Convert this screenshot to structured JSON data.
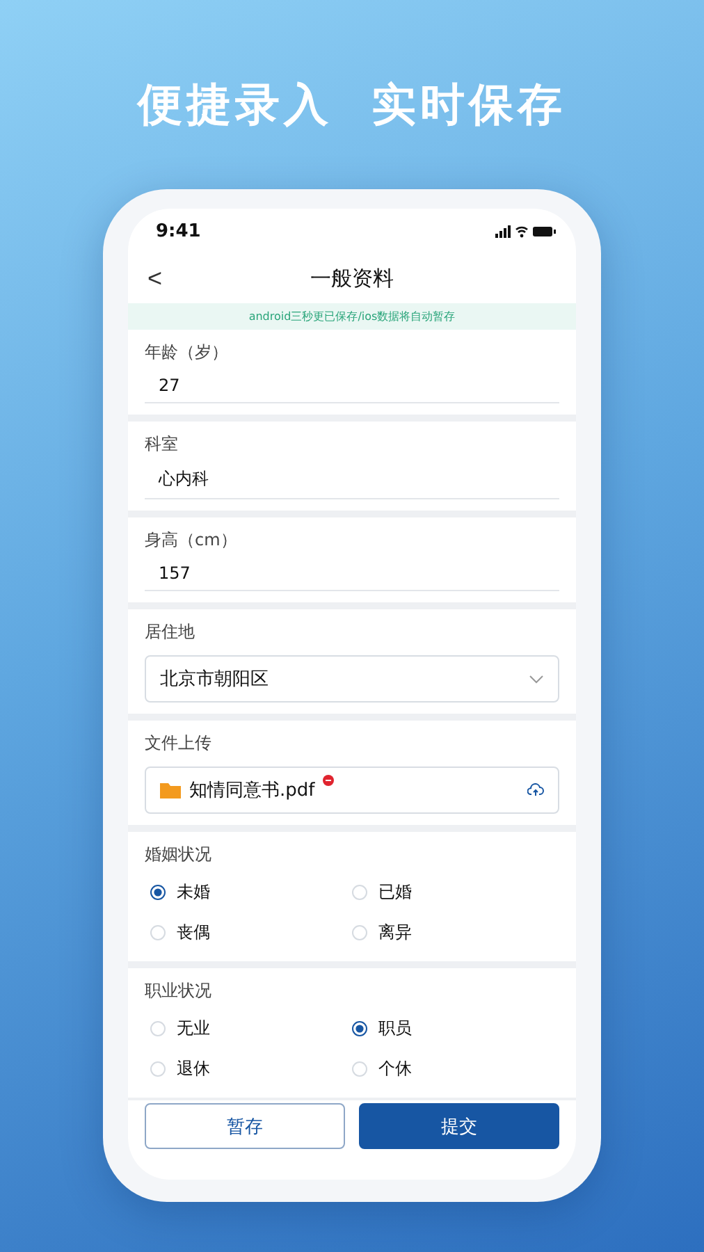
{
  "headline": "便捷录入  实时保存",
  "status_bar": {
    "time": "9:41"
  },
  "nav": {
    "back": "<",
    "title": "一般资料"
  },
  "notice": "android三秒更已保存/ios数据将自动暂存",
  "sections": [
    {
      "kind": "text",
      "label": "年龄（岁）",
      "value": "27"
    },
    {
      "kind": "text",
      "label": "科室",
      "value": "心内科"
    },
    {
      "kind": "text",
      "label": "身高（cm）",
      "value": "157"
    },
    {
      "kind": "select",
      "label": "居住地",
      "value": "北京市朝阳区"
    },
    {
      "kind": "upload",
      "label": "文件上传",
      "file": "知情同意书.pdf"
    },
    {
      "kind": "radio",
      "label": "婚姻状况",
      "options": [
        {
          "label": "未婚",
          "selected": true
        },
        {
          "label": "已婚",
          "selected": false
        },
        {
          "label": "丧偶",
          "selected": false
        },
        {
          "label": "离异",
          "selected": false
        }
      ]
    },
    {
      "kind": "radio",
      "label": "职业状况",
      "options": [
        {
          "label": "无业",
          "selected": false
        },
        {
          "label": "职员",
          "selected": true
        },
        {
          "label": "退休",
          "selected": false
        },
        {
          "label": "个休",
          "selected": false
        }
      ]
    }
  ],
  "buttons": [
    {
      "label": "暂存",
      "kind": "secondary"
    },
    {
      "label": "提交",
      "kind": "primary"
    }
  ]
}
